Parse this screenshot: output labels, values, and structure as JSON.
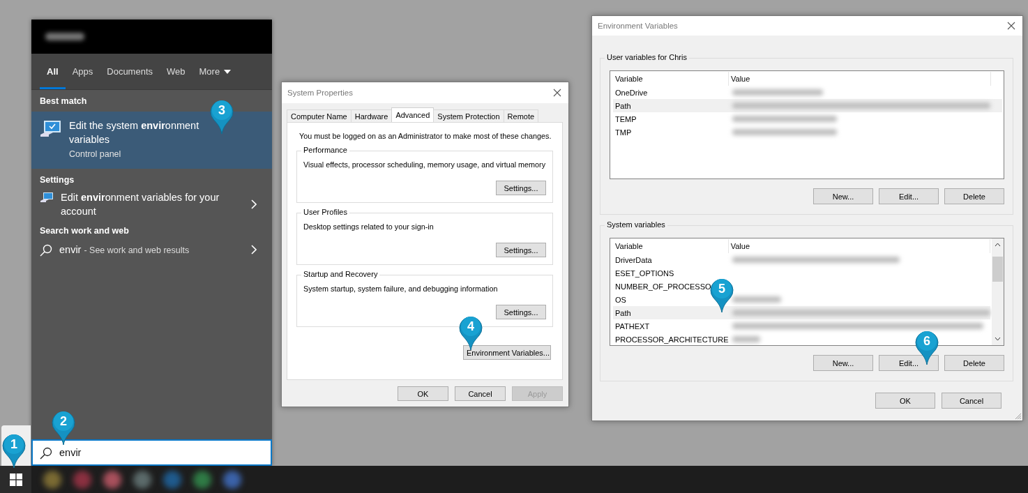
{
  "start_menu": {
    "tabs": [
      {
        "label": "All",
        "selected": true
      },
      {
        "label": "Apps",
        "selected": false
      },
      {
        "label": "Documents",
        "selected": false
      },
      {
        "label": "Web",
        "selected": false
      },
      {
        "label": "More",
        "selected": false,
        "kind": "dropdown"
      }
    ],
    "sections": [
      {
        "heading": "Best match",
        "results": [
          {
            "kind": "app",
            "title": "Edit the system **envir**onment variables",
            "subtitle": "Control panel",
            "selected": true
          }
        ]
      },
      {
        "heading": "Settings",
        "results": [
          {
            "kind": "setting",
            "title": "Edit **envir**onment variables for your account",
            "selected": false
          }
        ]
      },
      {
        "heading": "Search work and web",
        "results": [
          {
            "kind": "web",
            "query": "envir",
            "detail": "- See work and web results",
            "selected": false
          }
        ]
      }
    ],
    "search": {
      "value": "envir"
    }
  },
  "system_properties": {
    "title": "System Properties",
    "tabs": [
      {
        "label": "Computer Name",
        "selected": false
      },
      {
        "label": "Hardware",
        "selected": false
      },
      {
        "label": "Advanced",
        "selected": true
      },
      {
        "label": "System Protection",
        "selected": false
      },
      {
        "label": "Remote",
        "selected": false
      }
    ],
    "notice": "You must be logged on as an Administrator to make most of these changes.",
    "groups": [
      {
        "title": "Performance",
        "description": "Visual effects, processor scheduling, memory usage, and virtual memory",
        "button": "Settings..."
      },
      {
        "title": "User Profiles",
        "description": "Desktop settings related to your sign-in",
        "button": "Settings..."
      },
      {
        "title": "Startup and Recovery",
        "description": "System startup, system failure, and debugging information",
        "button": "Settings..."
      }
    ],
    "env_button": "Environment Variables...",
    "buttons": [
      {
        "label": "OK",
        "disabled": false
      },
      {
        "label": "Cancel",
        "disabled": false
      },
      {
        "label": "Apply",
        "disabled": true
      }
    ]
  },
  "environment_variables": {
    "title": "Environment Variables",
    "groups": [
      {
        "title": "User variables for Chris",
        "columns": [
          "Variable",
          "Value"
        ],
        "scrollbar": false,
        "rows": [
          {
            "variable": "OneDrive",
            "selected": false
          },
          {
            "variable": "Path",
            "selected": true
          },
          {
            "variable": "TEMP",
            "selected": false
          },
          {
            "variable": "TMP",
            "selected": false
          }
        ],
        "buttons": [
          "New...",
          "Edit...",
          "Delete"
        ]
      },
      {
        "title": "System variables",
        "columns": [
          "Variable",
          "Value"
        ],
        "scrollbar": true,
        "rows": [
          {
            "variable": "DriverData",
            "selected": false
          },
          {
            "variable": "ESET_OPTIONS",
            "selected": false
          },
          {
            "variable": "NUMBER_OF_PROCESSO",
            "selected": false
          },
          {
            "variable": "OS",
            "selected": false
          },
          {
            "variable": "Path",
            "selected": true
          },
          {
            "variable": "PATHEXT",
            "selected": false
          },
          {
            "variable": "PROCESSOR_ARCHITECTURE",
            "selected": false
          }
        ],
        "buttons": [
          "New...",
          "Edit...",
          "Delete"
        ]
      }
    ],
    "buttons": [
      "OK",
      "Cancel"
    ]
  },
  "callouts": [
    {
      "number": "1"
    },
    {
      "number": "2"
    },
    {
      "number": "3"
    },
    {
      "number": "4"
    },
    {
      "number": "5"
    },
    {
      "number": "6"
    }
  ]
}
